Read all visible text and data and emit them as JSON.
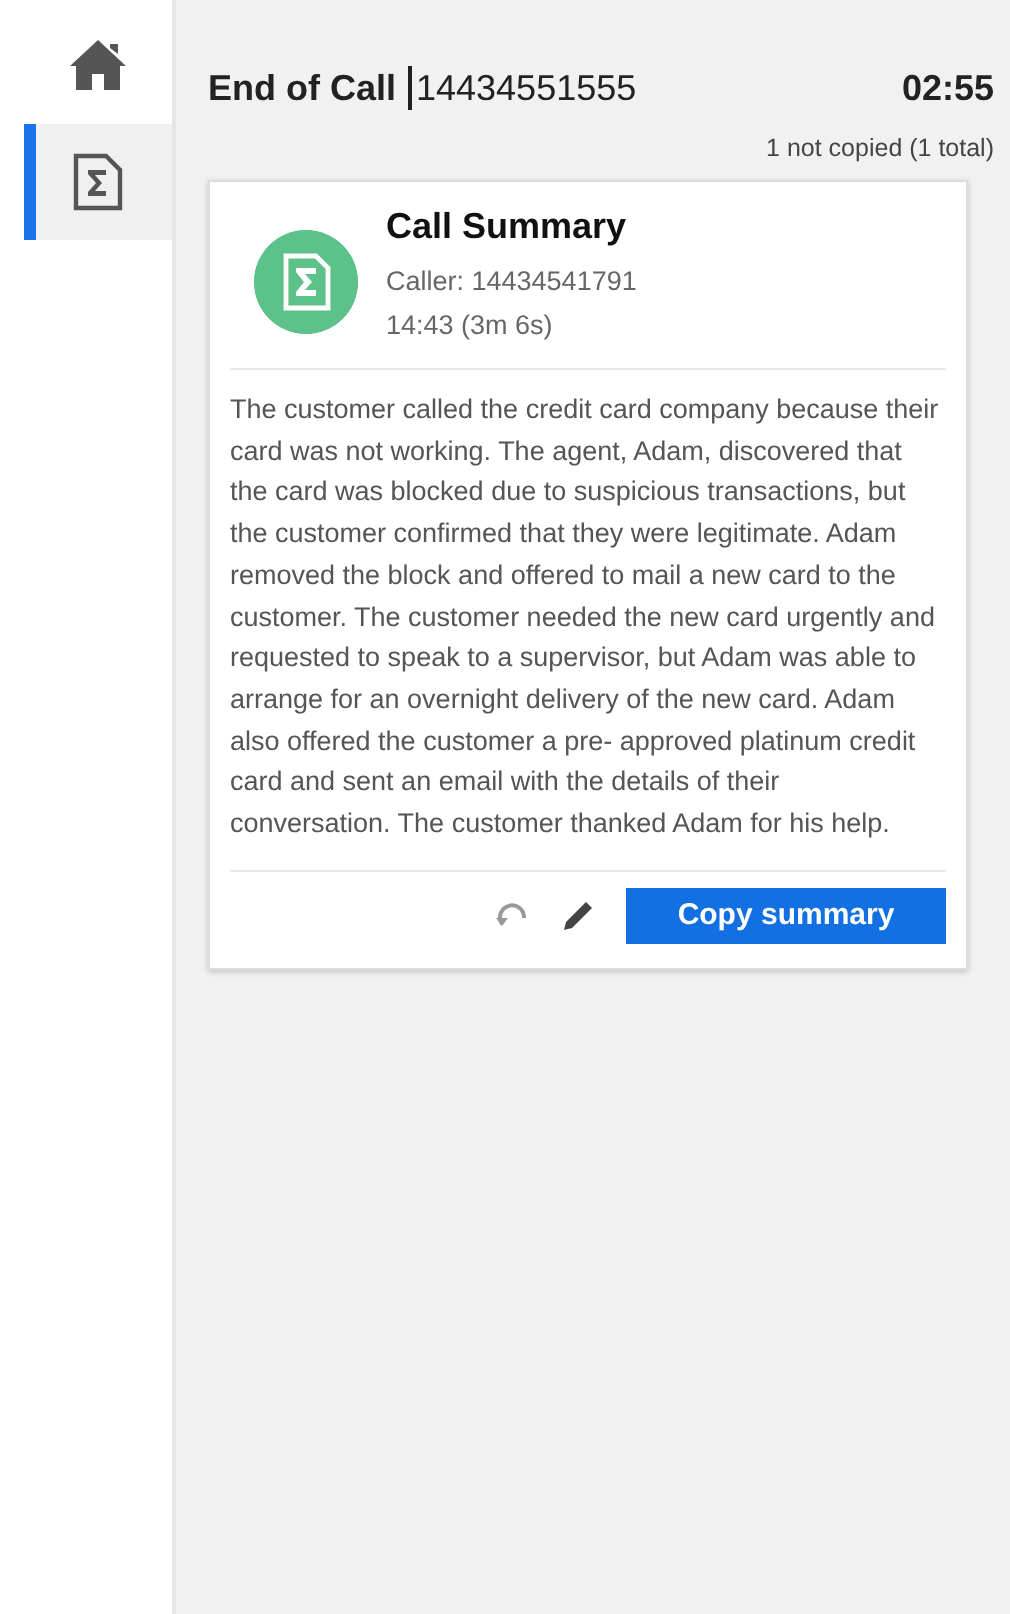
{
  "sidebar": {
    "items": [
      {
        "kind": "home",
        "selected": false
      },
      {
        "kind": "summary",
        "selected": true
      }
    ]
  },
  "header": {
    "title": "End of Call",
    "phone": "14434551555",
    "timer": "02:55",
    "copy_status": "1 not copied (1 total)"
  },
  "card": {
    "title": "Call Summary",
    "caller": "Caller: 14434541791",
    "time": "14:43 (3m 6s)",
    "summary": "The customer called the credit card company because their card was not working. The agent, Adam, discovered that the card was blocked due to suspicious transactions, but the customer confirmed that they were legitimate. Adam removed the block and offered to mail a new card to the customer. The customer needed the new card urgently and requested to speak to a supervisor, but Adam was able to arrange for an overnight delivery of the new card. Adam also offered the customer a pre- approved platinum credit card and sent an email with the details of their conversation. The customer thanked Adam for his help.",
    "copy_button": "Copy summary"
  }
}
